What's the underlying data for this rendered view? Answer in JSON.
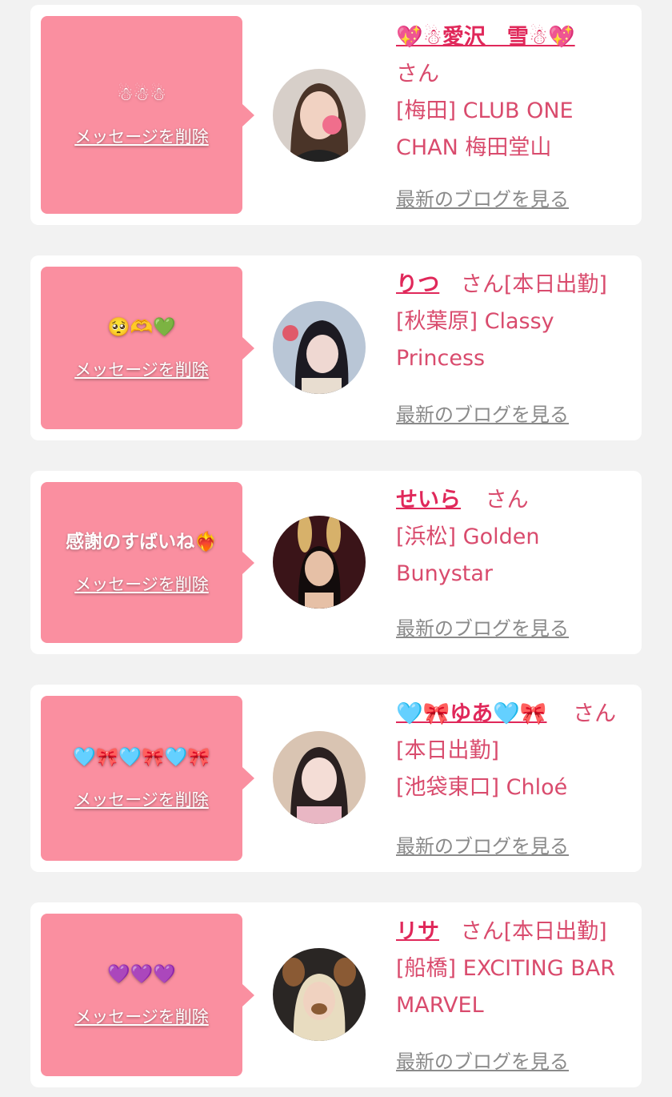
{
  "entries": [
    {
      "message": "☃☃☃",
      "delete_label": "メッセージを削除",
      "name": "💖☃愛沢　雪☃💖",
      "suffix": "さん",
      "shop": "[梅田] CLUB ONE CHAN 梅田堂山",
      "blog_label": "最新のブログを見る"
    },
    {
      "message": "🥺🫶💚",
      "delete_label": "メッセージを削除",
      "name": "りつ",
      "suffix": "さん[本日出勤]",
      "shop": "[秋葉原] Classy Princess",
      "blog_label": "最新のブログを見る"
    },
    {
      "message": "感謝のすばいね❤️‍🔥",
      "delete_label": "メッセージを削除",
      "name": "せいら",
      "suffix": "さん",
      "shop": "[浜松] Golden Bunystar",
      "blog_label": "最新のブログを見る"
    },
    {
      "message": "🩵🎀🩵🎀🩵🎀",
      "delete_label": "メッセージを削除",
      "name": "🩵🎀ゆあ🩵🎀",
      "suffix": "さん[本日出勤]",
      "shop": "[池袋東口] Chloé",
      "blog_label": "最新のブログを見る"
    },
    {
      "message": "💜💜💜",
      "delete_label": "メッセージを削除",
      "name": "リサ",
      "suffix": "さん[本日出勤]",
      "shop": "[船橋] EXCITING BAR MARVEL",
      "blog_label": "最新のブログを見る"
    }
  ]
}
